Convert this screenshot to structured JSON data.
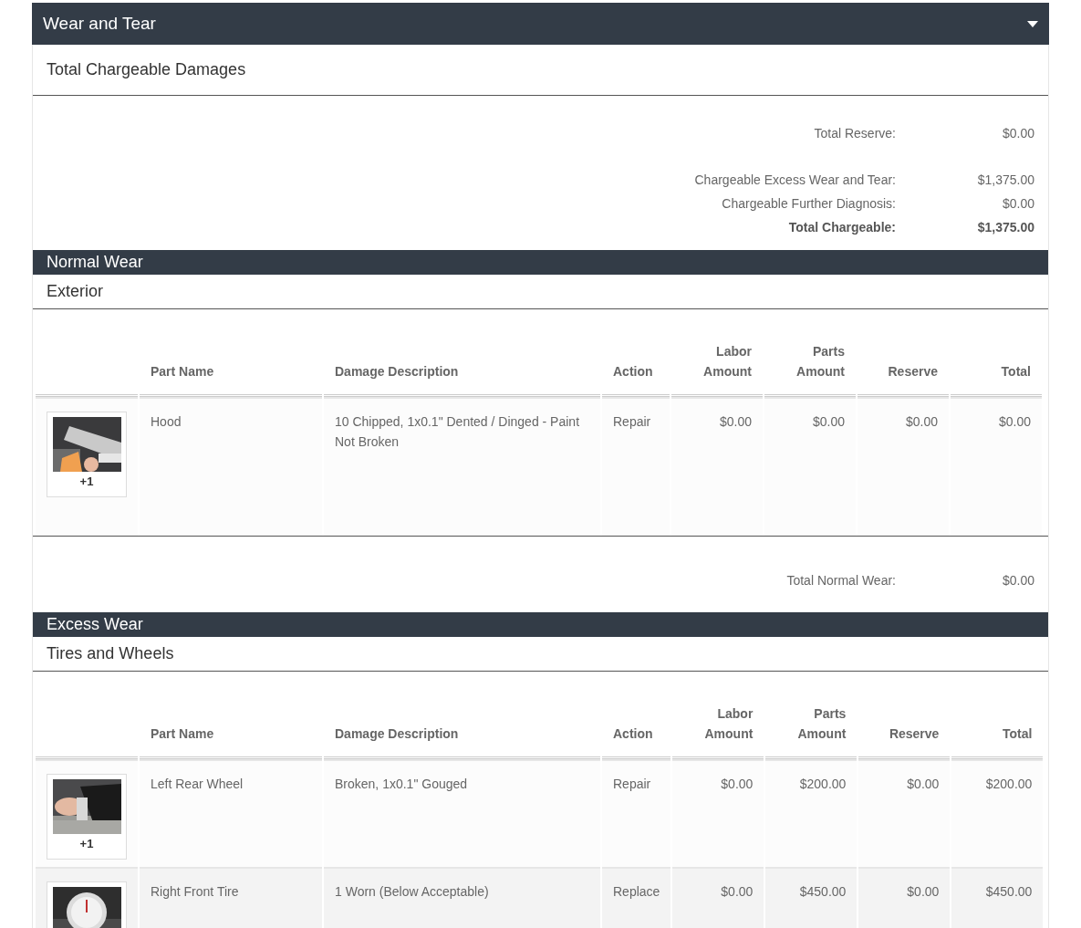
{
  "panel": {
    "title": "Wear and Tear",
    "expanded": true
  },
  "summary": {
    "title": "Total Chargeable Damages",
    "lines": [
      {
        "label": "Total Reserve:",
        "value": "$0.00",
        "bold": false
      },
      {
        "label": "Chargeable Excess Wear and Tear:",
        "value": "$1,375.00",
        "bold": false
      },
      {
        "label": "Chargeable Further Diagnosis:",
        "value": "$0.00",
        "bold": false
      },
      {
        "label": "Total Chargeable:",
        "value": "$1,375.00",
        "bold": true
      }
    ]
  },
  "sections": [
    {
      "title": "Normal Wear",
      "groups": [
        {
          "title": "Exterior",
          "columns": [
            "Part Name",
            "Damage Description",
            "Action",
            "Labor Amount",
            "Parts Amount",
            "Reserve",
            "Total"
          ],
          "rows": [
            {
              "photo": {
                "kind": "picture",
                "count": "+1"
              },
              "cells": [
                "Hood",
                "10 Chipped, 1x0.1\" Dented / Dinged - Paint Not Broken",
                "Repair",
                "$0.00",
                "$0.00",
                "$0.00",
                "$0.00"
              ]
            }
          ]
        }
      ],
      "footer": {
        "label": "Total Normal Wear:",
        "value": "$0.00"
      }
    },
    {
      "title": "Excess Wear",
      "groups": [
        {
          "title": "Tires and Wheels",
          "columns": [
            "Part Name",
            "Damage Description",
            "Action",
            "Labor Amount",
            "Parts Amount",
            "Reserve",
            "Total"
          ],
          "rows": [
            {
              "photo": {
                "kind": "picture",
                "count": "+1"
              },
              "cells": [
                "Left Rear Wheel",
                "Broken, 1x0.1\" Gouged",
                "Repair",
                "$0.00",
                "$200.00",
                "$0.00",
                "$200.00"
              ]
            },
            {
              "cells": [
                "Right Front Tire",
                "1 Worn (Below Acceptable)",
                "Replace",
                "$0.00",
                "$450.00",
                "$0.00",
                "$450.00"
              ]
            }
          ]
        }
      ]
    }
  ]
}
